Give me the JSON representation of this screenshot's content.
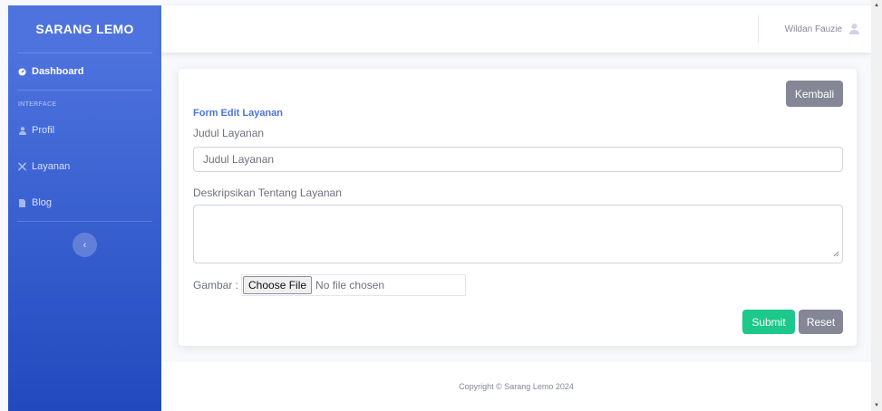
{
  "sidebar": {
    "brand": "SARANG LEMO",
    "dashboard_label": "Dashboard",
    "heading": "INTERFACE",
    "items": [
      {
        "label": "Profil",
        "icon": "user-icon"
      },
      {
        "label": "Layanan",
        "icon": "tools-icon"
      },
      {
        "label": "Blog",
        "icon": "file-icon"
      }
    ],
    "toggle_icon": "chevron-left-icon"
  },
  "topbar": {
    "user_name": "Wildan Fauzie",
    "avatar_icon": "user-icon"
  },
  "form": {
    "back_button": "Kembali",
    "title": "Form Edit Layanan",
    "judul_label": "Judul Layanan",
    "judul_placeholder": "Judul Layanan",
    "deskripsi_label": "Deskripsikan Tentang Layanan",
    "gambar_label": "Gambar :",
    "file_button": "Choose File",
    "file_status": "No file chosen",
    "submit_button": "Submit",
    "reset_button": "Reset"
  },
  "footer": {
    "copyright": "Copyright © Sarang Lemo 2024"
  },
  "colors": {
    "primary": "#4e73df",
    "primary_dark": "#224abe",
    "secondary": "#858796",
    "success": "#1cc88a"
  }
}
